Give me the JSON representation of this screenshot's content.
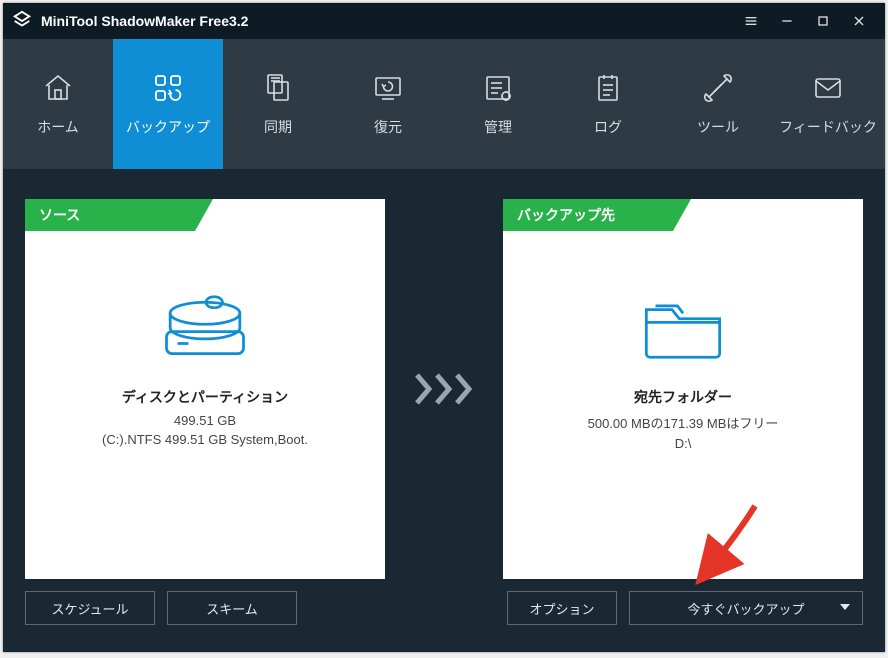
{
  "titlebar": {
    "title": "MiniTool ShadowMaker Free3.2"
  },
  "nav": {
    "items": [
      {
        "label": "ホーム"
      },
      {
        "label": "バックアップ"
      },
      {
        "label": "同期"
      },
      {
        "label": "復元"
      },
      {
        "label": "管理"
      },
      {
        "label": "ログ"
      },
      {
        "label": "ツール"
      },
      {
        "label": "フィードバック"
      }
    ],
    "active_index": 1
  },
  "source_panel": {
    "tag": "ソース",
    "caption": "ディスクとパーティション",
    "size": "499.51 GB",
    "detail": "(C:).NTFS 499.51 GB System,Boot."
  },
  "dest_panel": {
    "tag": "バックアップ先",
    "caption": "宛先フォルダー",
    "size": "500.00 MBの171.39 MBはフリー",
    "detail": "D:\\"
  },
  "buttons": {
    "schedule": "スケジュール",
    "scheme": "スキーム",
    "options": "オプション",
    "backup_now": "今すぐバックアップ"
  },
  "colors": {
    "accent": "#0f8ed6",
    "green": "#29b24a",
    "dark": "#1a2833"
  }
}
